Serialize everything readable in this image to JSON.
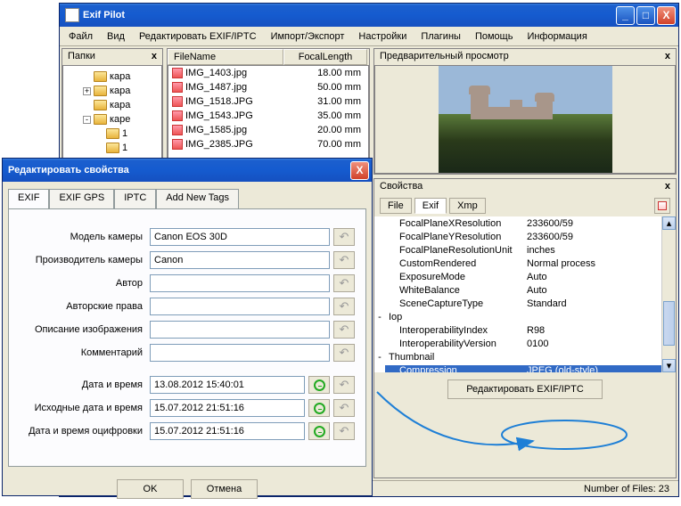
{
  "main_window": {
    "title": "Exif Pilot",
    "menu": [
      "Файл",
      "Вид",
      "Редактировать EXIF/IPTC",
      "Импорт/Экспорт",
      "Настройки",
      "Плагины",
      "Помощь",
      "Информация"
    ]
  },
  "folders": {
    "header": "Папки",
    "items": [
      {
        "indent": 0,
        "exp": "",
        "name": "кара"
      },
      {
        "indent": 0,
        "exp": "+",
        "name": "кара"
      },
      {
        "indent": 0,
        "exp": "",
        "name": "кара"
      },
      {
        "indent": 0,
        "exp": "-",
        "name": "каре"
      },
      {
        "indent": 1,
        "exp": "",
        "name": "1"
      },
      {
        "indent": 1,
        "exp": "",
        "name": "1"
      }
    ]
  },
  "files": {
    "cols": [
      "FileName",
      "FocalLength"
    ],
    "rows": [
      {
        "fn": "IMG_1403.jpg",
        "fl": "18.00 mm"
      },
      {
        "fn": "IMG_1487.jpg",
        "fl": "50.00 mm"
      },
      {
        "fn": "IMG_1518.JPG",
        "fl": "31.00 mm"
      },
      {
        "fn": "IMG_1543.JPG",
        "fl": "35.00 mm"
      },
      {
        "fn": "IMG_1585.jpg",
        "fl": "20.00 mm"
      },
      {
        "fn": "IMG_2385.JPG",
        "fl": "70.00 mm"
      }
    ]
  },
  "preview": {
    "header": "Предварительный просмотр"
  },
  "properties": {
    "header": "Свойства",
    "tabs": [
      "File",
      "Exif",
      "Xmp"
    ],
    "active_tab": "Exif",
    "rows": [
      {
        "exp": "",
        "k": "FocalPlaneXResolution",
        "v": "233600/59"
      },
      {
        "exp": "",
        "k": "FocalPlaneYResolution",
        "v": "233600/59"
      },
      {
        "exp": "",
        "k": "FocalPlaneResolutionUnit",
        "v": "inches"
      },
      {
        "exp": "",
        "k": "CustomRendered",
        "v": "Normal process"
      },
      {
        "exp": "",
        "k": "ExposureMode",
        "v": "Auto"
      },
      {
        "exp": "",
        "k": "WhiteBalance",
        "v": "Auto"
      },
      {
        "exp": "",
        "k": "SceneCaptureType",
        "v": "Standard"
      },
      {
        "exp": "-",
        "k": "Iop",
        "v": ""
      },
      {
        "exp": "",
        "k": "InteroperabilityIndex",
        "v": "R98"
      },
      {
        "exp": "",
        "k": "InteroperabilityVersion",
        "v": "0100"
      },
      {
        "exp": "-",
        "k": "Thumbnail",
        "v": ""
      },
      {
        "exp": "",
        "k": "Compression",
        "v": "JPEG (old-style)",
        "sel": true
      }
    ],
    "button": "Редактировать EXIF/IPTC"
  },
  "status": "Number of Files: 23",
  "dialog": {
    "title": "Редактировать свойства",
    "tabs": [
      "EXIF",
      "EXIF GPS",
      "IPTC",
      "Add New Tags"
    ],
    "active_tab": "EXIF",
    "fields": [
      {
        "label": "Модель камеры",
        "value": "Canon EOS 30D",
        "kind": "text"
      },
      {
        "label": "Производитель камеры",
        "value": "Canon",
        "kind": "text"
      },
      {
        "label": "Автор",
        "value": "",
        "kind": "text"
      },
      {
        "label": "Авторские права",
        "value": "",
        "kind": "text"
      },
      {
        "label": "Описание изображения",
        "value": "",
        "kind": "text"
      },
      {
        "label": "Комментарий",
        "value": "",
        "kind": "text"
      },
      {
        "label": "Дата и время",
        "value": "13.08.2012 15:40:01",
        "kind": "date"
      },
      {
        "label": "Исходные дата и время",
        "value": "15.07.2012 21:51:16",
        "kind": "date"
      },
      {
        "label": "Дата и время оцифровки",
        "value": "15.07.2012 21:51:16",
        "kind": "date"
      }
    ],
    "ok": "OK",
    "cancel": "Отмена"
  }
}
